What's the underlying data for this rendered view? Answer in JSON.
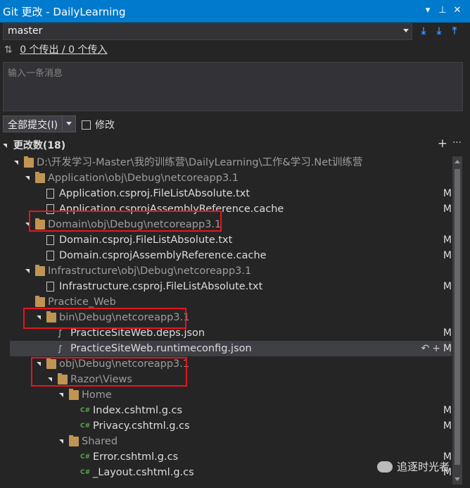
{
  "window": {
    "title": "Git 更改 - DailyLearning"
  },
  "branch": {
    "name": "master"
  },
  "toolbar_icons": [
    "fetch-icon",
    "pull-icon",
    "push-icon"
  ],
  "sync": {
    "arrows": "⇅",
    "text": "0 个传出 / 0 个传入"
  },
  "message": {
    "placeholder": "输入一条消息"
  },
  "commit": {
    "label": "全部提交(I)"
  },
  "amend": {
    "label": "修改"
  },
  "changes": {
    "header": "更改数(18)"
  },
  "tree": [
    {
      "text": "D:\\开发学习-Master\\我的训练营\\DailyLearning\\工作&学习.Net训练营",
      "type": "folder",
      "dim": true,
      "status": ""
    },
    {
      "text": "Application\\obj\\Debug\\netcoreapp3.1",
      "type": "folder",
      "dim": true,
      "status": ""
    },
    {
      "text": "Application.csproj.FileListAbsolute.txt",
      "type": "file",
      "dim": false,
      "status": "M"
    },
    {
      "text": "Application.csprojAssemblyReference.cache",
      "type": "bin",
      "dim": false,
      "status": "M"
    },
    {
      "text": "Domain\\obj\\Debug\\netcoreapp3.1",
      "type": "folder",
      "dim": true,
      "status": ""
    },
    {
      "text": "Domain.csproj.FileListAbsolute.txt",
      "type": "file",
      "dim": false,
      "status": "M"
    },
    {
      "text": "Domain.csprojAssemblyReference.cache",
      "type": "bin",
      "dim": false,
      "status": "M"
    },
    {
      "text": "Infrastructure\\obj\\Debug\\netcoreapp3.1",
      "type": "folder",
      "dim": true,
      "status": ""
    },
    {
      "text": "Infrastructure.csproj.FileListAbsolute.txt",
      "type": "file",
      "dim": false,
      "status": "M"
    },
    {
      "text": "Practice_Web",
      "type": "folder",
      "dim": true,
      "status": ""
    },
    {
      "text": "bin\\Debug\\netcoreapp3.1",
      "type": "folder",
      "dim": true,
      "status": ""
    },
    {
      "text": "PracticeSiteWeb.deps.json",
      "type": "json",
      "dim": false,
      "status": "M"
    },
    {
      "text": "PracticeSiteWeb.runtimeconfig.json",
      "type": "json",
      "dim": false,
      "status": "M"
    },
    {
      "text": "obj\\Debug\\netcoreapp3.1",
      "type": "folder",
      "dim": true,
      "status": ""
    },
    {
      "text": "Razor\\Views",
      "type": "folder",
      "dim": true,
      "status": ""
    },
    {
      "text": "Home",
      "type": "folder",
      "dim": true,
      "status": ""
    },
    {
      "text": "Index.cshtml.g.cs",
      "type": "cs",
      "dim": false,
      "status": "M"
    },
    {
      "text": "Privacy.cshtml.g.cs",
      "type": "cs",
      "dim": false,
      "status": "M"
    },
    {
      "text": "Shared",
      "type": "folder",
      "dim": true,
      "status": ""
    },
    {
      "text": "Error.cshtml.g.cs",
      "type": "cs",
      "dim": false,
      "status": "M"
    },
    {
      "text": "_Layout.cshtml.g.cs",
      "type": "cs",
      "dim": false,
      "status": "M"
    }
  ],
  "row_actions": {
    "undo": "↶",
    "stage": "+"
  },
  "watermark": {
    "text": "追逐时光者"
  },
  "colors": {
    "titlebar": "#007acc",
    "highlight": "#e8141e",
    "background": "#252526"
  }
}
